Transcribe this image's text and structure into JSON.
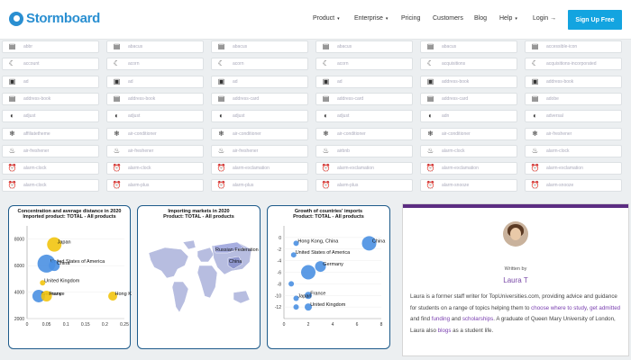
{
  "brand": {
    "name": "Stormboard"
  },
  "nav": {
    "items": [
      {
        "label": "Product",
        "caret": "▾"
      },
      {
        "label": "Enterprise",
        "caret": "▾"
      },
      {
        "label": "Pricing",
        "caret": ""
      },
      {
        "label": "Customers",
        "caret": ""
      },
      {
        "label": "Blog",
        "caret": ""
      },
      {
        "label": "Help",
        "caret": "▾"
      },
      {
        "label": "Login →",
        "caret": ""
      }
    ],
    "signup_label": "Sign Up Free"
  },
  "icon_grid": {
    "columns": [
      [
        "abbr",
        "account",
        "ad",
        "address-book",
        "adjust",
        "affiliatetheme",
        "air-freshener",
        "alarm-clock",
        "alarm-clock"
      ],
      [
        "abacus",
        "acorn",
        "ad",
        "address-book",
        "adjust",
        "air-conditioner",
        "air-freshener",
        "alarm-clock",
        "alarm-plus"
      ],
      [
        "abacus",
        "acorn",
        "ad",
        "address-card",
        "adjust",
        "air-conditioner",
        "air-freshener",
        "alarm-exclamation",
        "alarm-plus"
      ],
      [
        "abacus",
        "acorn",
        "ad",
        "address-card",
        "adjust",
        "air-conditioner",
        "airbnb",
        "alarm-exclamation",
        "alarm-plus"
      ],
      [
        "abacus",
        "acquisitions",
        "address-book",
        "address-card",
        "adn",
        "air-conditioner",
        "alarm-clock",
        "alarm-exclamation",
        "alarm-snooze"
      ],
      [
        "accessible-icon",
        "acquisitions-incorporated",
        "address-book",
        "adobe",
        "adversal",
        "air-freshener",
        "alarm-clock",
        "alarm-exclamation",
        "alarm-snooze"
      ]
    ],
    "row_glyphs": [
      "▤",
      "☾",
      "▣",
      "▤",
      "◐",
      "❄",
      "♨",
      "⏰",
      "⏰"
    ]
  },
  "charts": {
    "bubble": {
      "title_line1": "Concentration and average distance in 2020",
      "title_line2": "Imported product: TOTAL - All products"
    },
    "map": {
      "title_line1": "Importing markets in 2020",
      "title_line2": "Product: TOTAL - All products"
    },
    "growth": {
      "title_line1": "Growth of countries' imports",
      "title_line2": "Product: TOTAL - All products"
    }
  },
  "chart_data": [
    {
      "type": "scatter",
      "title": "Concentration and average distance in 2020",
      "subtitle": "Imported product: TOTAL - All products",
      "xlim": [
        0,
        0.25
      ],
      "ylim": [
        2000,
        9000
      ],
      "xticks": [
        "0",
        "0.05",
        "0.1",
        "0.15",
        "0.2",
        "0.25"
      ],
      "yticks": [
        "8000",
        "6000",
        "4000",
        "2000"
      ],
      "points": [
        {
          "label": "Japan",
          "x": 0.07,
          "y": 7600,
          "r": 8,
          "color": "#f2c40f"
        },
        {
          "label": "United States of America",
          "x": 0.05,
          "y": 6150,
          "r": 10,
          "color": "#4a90e2"
        },
        {
          "label": "China",
          "x": 0.07,
          "y": 6000,
          "r": 6,
          "color": "#4a90e2"
        },
        {
          "label": "United Kingdom",
          "x": 0.04,
          "y": 4700,
          "r": 3,
          "color": "#f2c40f"
        },
        {
          "label": "Germany",
          "x": 0.03,
          "y": 3700,
          "r": 7,
          "color": "#4a90e2"
        },
        {
          "label": "France",
          "x": 0.05,
          "y": 3700,
          "r": 6,
          "color": "#f2c40f"
        },
        {
          "label": "Hong Kong, China",
          "x": 0.22,
          "y": 3700,
          "r": 5,
          "color": "#f2c40f"
        }
      ]
    },
    {
      "type": "map",
      "title": "Importing markets in 2020",
      "subtitle": "Product: TOTAL - All products",
      "labels": [
        "Russian Federation",
        "China"
      ]
    },
    {
      "type": "scatter",
      "title": "Growth of countries' imports",
      "subtitle": "Product: TOTAL - All products",
      "xlim": [
        0,
        8
      ],
      "ylim": [
        -14,
        2
      ],
      "xticks": [
        "0",
        "2",
        "4",
        "6",
        "8"
      ],
      "yticks": [
        "0",
        "-2",
        "-4",
        "-6",
        "-8",
        "-10",
        "-12"
      ],
      "points": [
        {
          "label": "Hong Kong, China",
          "x": 1,
          "y": -1,
          "r": 3
        },
        {
          "label": "China",
          "x": 7,
          "y": -1,
          "r": 8
        },
        {
          "label": "United States of America",
          "x": 0.8,
          "y": -3,
          "r": 3
        },
        {
          "label": "Germany",
          "x": 3,
          "y": -5,
          "r": 6
        },
        {
          "label": "",
          "x": 2,
          "y": -6,
          "r": 8
        },
        {
          "label": "",
          "x": 0.6,
          "y": -8,
          "r": 3
        },
        {
          "label": "France",
          "x": 2,
          "y": -10,
          "r": 4
        },
        {
          "label": "Japan",
          "x": 1,
          "y": -10.5,
          "r": 3
        },
        {
          "label": "United Kingdom",
          "x": 2,
          "y": -12,
          "r": 4
        },
        {
          "label": "",
          "x": 1,
          "y": -12,
          "r": 3
        }
      ]
    }
  ],
  "author": {
    "written_by": "Written by",
    "name": "Laura T",
    "bio_pre": "Laura is a former staff writer for TopUniversities.com, providing advice and guidance for students on a range of topics helping them to ",
    "bio_link1": "choose where to study",
    "bio_mid1": ", ",
    "bio_link2": "get admitted",
    "bio_mid2": " and find ",
    "bio_link3": "funding",
    "bio_mid3": " and ",
    "bio_link4": "scholarships",
    "bio_mid4": ". A graduate of Queen Mary University of London, Laura also ",
    "bio_link5": "blogs",
    "bio_post": " as a student life."
  },
  "colors": {
    "brand": "#2a8fd1",
    "signup": "#13a4e0",
    "accent_purple": "#5b2d82",
    "bubble_blue": "#4a90e2",
    "bubble_yellow": "#f2c40f"
  }
}
